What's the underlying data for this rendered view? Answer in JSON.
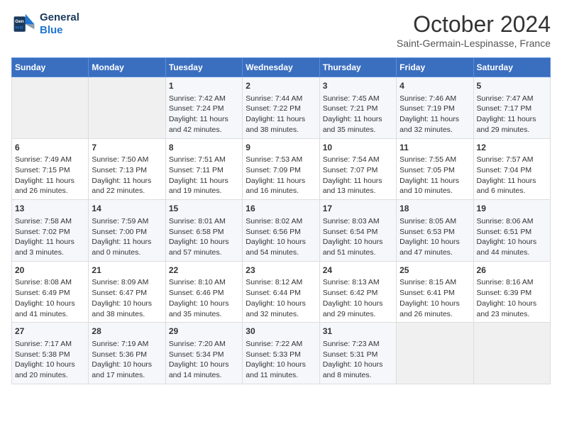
{
  "logo": {
    "line1": "General",
    "line2": "Blue"
  },
  "title": "October 2024",
  "location": "Saint-Germain-Lespinasse, France",
  "days_of_week": [
    "Sunday",
    "Monday",
    "Tuesday",
    "Wednesday",
    "Thursday",
    "Friday",
    "Saturday"
  ],
  "weeks": [
    [
      {
        "day": "",
        "sunrise": "",
        "sunset": "",
        "daylight": ""
      },
      {
        "day": "",
        "sunrise": "",
        "sunset": "",
        "daylight": ""
      },
      {
        "day": "1",
        "sunrise": "Sunrise: 7:42 AM",
        "sunset": "Sunset: 7:24 PM",
        "daylight": "Daylight: 11 hours and 42 minutes."
      },
      {
        "day": "2",
        "sunrise": "Sunrise: 7:44 AM",
        "sunset": "Sunset: 7:22 PM",
        "daylight": "Daylight: 11 hours and 38 minutes."
      },
      {
        "day": "3",
        "sunrise": "Sunrise: 7:45 AM",
        "sunset": "Sunset: 7:21 PM",
        "daylight": "Daylight: 11 hours and 35 minutes."
      },
      {
        "day": "4",
        "sunrise": "Sunrise: 7:46 AM",
        "sunset": "Sunset: 7:19 PM",
        "daylight": "Daylight: 11 hours and 32 minutes."
      },
      {
        "day": "5",
        "sunrise": "Sunrise: 7:47 AM",
        "sunset": "Sunset: 7:17 PM",
        "daylight": "Daylight: 11 hours and 29 minutes."
      }
    ],
    [
      {
        "day": "6",
        "sunrise": "Sunrise: 7:49 AM",
        "sunset": "Sunset: 7:15 PM",
        "daylight": "Daylight: 11 hours and 26 minutes."
      },
      {
        "day": "7",
        "sunrise": "Sunrise: 7:50 AM",
        "sunset": "Sunset: 7:13 PM",
        "daylight": "Daylight: 11 hours and 22 minutes."
      },
      {
        "day": "8",
        "sunrise": "Sunrise: 7:51 AM",
        "sunset": "Sunset: 7:11 PM",
        "daylight": "Daylight: 11 hours and 19 minutes."
      },
      {
        "day": "9",
        "sunrise": "Sunrise: 7:53 AM",
        "sunset": "Sunset: 7:09 PM",
        "daylight": "Daylight: 11 hours and 16 minutes."
      },
      {
        "day": "10",
        "sunrise": "Sunrise: 7:54 AM",
        "sunset": "Sunset: 7:07 PM",
        "daylight": "Daylight: 11 hours and 13 minutes."
      },
      {
        "day": "11",
        "sunrise": "Sunrise: 7:55 AM",
        "sunset": "Sunset: 7:05 PM",
        "daylight": "Daylight: 11 hours and 10 minutes."
      },
      {
        "day": "12",
        "sunrise": "Sunrise: 7:57 AM",
        "sunset": "Sunset: 7:04 PM",
        "daylight": "Daylight: 11 hours and 6 minutes."
      }
    ],
    [
      {
        "day": "13",
        "sunrise": "Sunrise: 7:58 AM",
        "sunset": "Sunset: 7:02 PM",
        "daylight": "Daylight: 11 hours and 3 minutes."
      },
      {
        "day": "14",
        "sunrise": "Sunrise: 7:59 AM",
        "sunset": "Sunset: 7:00 PM",
        "daylight": "Daylight: 11 hours and 0 minutes."
      },
      {
        "day": "15",
        "sunrise": "Sunrise: 8:01 AM",
        "sunset": "Sunset: 6:58 PM",
        "daylight": "Daylight: 10 hours and 57 minutes."
      },
      {
        "day": "16",
        "sunrise": "Sunrise: 8:02 AM",
        "sunset": "Sunset: 6:56 PM",
        "daylight": "Daylight: 10 hours and 54 minutes."
      },
      {
        "day": "17",
        "sunrise": "Sunrise: 8:03 AM",
        "sunset": "Sunset: 6:54 PM",
        "daylight": "Daylight: 10 hours and 51 minutes."
      },
      {
        "day": "18",
        "sunrise": "Sunrise: 8:05 AM",
        "sunset": "Sunset: 6:53 PM",
        "daylight": "Daylight: 10 hours and 47 minutes."
      },
      {
        "day": "19",
        "sunrise": "Sunrise: 8:06 AM",
        "sunset": "Sunset: 6:51 PM",
        "daylight": "Daylight: 10 hours and 44 minutes."
      }
    ],
    [
      {
        "day": "20",
        "sunrise": "Sunrise: 8:08 AM",
        "sunset": "Sunset: 6:49 PM",
        "daylight": "Daylight: 10 hours and 41 minutes."
      },
      {
        "day": "21",
        "sunrise": "Sunrise: 8:09 AM",
        "sunset": "Sunset: 6:47 PM",
        "daylight": "Daylight: 10 hours and 38 minutes."
      },
      {
        "day": "22",
        "sunrise": "Sunrise: 8:10 AM",
        "sunset": "Sunset: 6:46 PM",
        "daylight": "Daylight: 10 hours and 35 minutes."
      },
      {
        "day": "23",
        "sunrise": "Sunrise: 8:12 AM",
        "sunset": "Sunset: 6:44 PM",
        "daylight": "Daylight: 10 hours and 32 minutes."
      },
      {
        "day": "24",
        "sunrise": "Sunrise: 8:13 AM",
        "sunset": "Sunset: 6:42 PM",
        "daylight": "Daylight: 10 hours and 29 minutes."
      },
      {
        "day": "25",
        "sunrise": "Sunrise: 8:15 AM",
        "sunset": "Sunset: 6:41 PM",
        "daylight": "Daylight: 10 hours and 26 minutes."
      },
      {
        "day": "26",
        "sunrise": "Sunrise: 8:16 AM",
        "sunset": "Sunset: 6:39 PM",
        "daylight": "Daylight: 10 hours and 23 minutes."
      }
    ],
    [
      {
        "day": "27",
        "sunrise": "Sunrise: 7:17 AM",
        "sunset": "Sunset: 5:38 PM",
        "daylight": "Daylight: 10 hours and 20 minutes."
      },
      {
        "day": "28",
        "sunrise": "Sunrise: 7:19 AM",
        "sunset": "Sunset: 5:36 PM",
        "daylight": "Daylight: 10 hours and 17 minutes."
      },
      {
        "day": "29",
        "sunrise": "Sunrise: 7:20 AM",
        "sunset": "Sunset: 5:34 PM",
        "daylight": "Daylight: 10 hours and 14 minutes."
      },
      {
        "day": "30",
        "sunrise": "Sunrise: 7:22 AM",
        "sunset": "Sunset: 5:33 PM",
        "daylight": "Daylight: 10 hours and 11 minutes."
      },
      {
        "day": "31",
        "sunrise": "Sunrise: 7:23 AM",
        "sunset": "Sunset: 5:31 PM",
        "daylight": "Daylight: 10 hours and 8 minutes."
      },
      {
        "day": "",
        "sunrise": "",
        "sunset": "",
        "daylight": ""
      },
      {
        "day": "",
        "sunrise": "",
        "sunset": "",
        "daylight": ""
      }
    ]
  ]
}
